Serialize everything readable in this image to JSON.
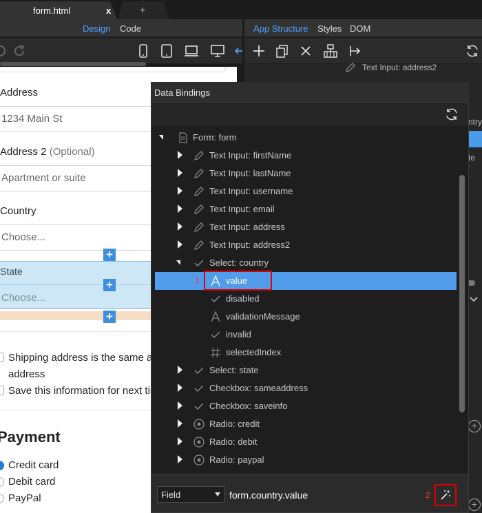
{
  "tabs": {
    "file": "form.html",
    "close": "x",
    "add": "+"
  },
  "left": {
    "modes": {
      "design": "Design",
      "code": "Code"
    }
  },
  "preview": {
    "address_label": "Address",
    "address_placeholder": "1234 Main St",
    "address2_label": "Address 2",
    "address2_optional": "(Optional)",
    "address2_placeholder": "Apartment or suite",
    "country_label": "Country",
    "country_value": "Choose...",
    "state_label": "State",
    "state_value": "Choose...",
    "plus": "+",
    "checkbox1": "Shipping address is the same as my billing address",
    "checkbox2": "Save this information for next time",
    "payment_title": "Payment",
    "radios": [
      "Credit card",
      "Debit card",
      "PayPal"
    ]
  },
  "right": {
    "tabs": {
      "app": "App Structure",
      "styles": "Styles",
      "dom": "DOM"
    },
    "selected_node": "Text Input: address2",
    "behind_text1": "ntry",
    "behind_text2": "te"
  },
  "bindings": {
    "title": "Data Bindings",
    "tree": [
      {
        "label": "Form: form",
        "icon": "document-icon"
      },
      {
        "label": "Text Input: firstName",
        "icon": "pencil-icon"
      },
      {
        "label": "Text Input: lastName",
        "icon": "pencil-icon"
      },
      {
        "label": "Text Input: username",
        "icon": "pencil-icon"
      },
      {
        "label": "Text Input: email",
        "icon": "pencil-icon"
      },
      {
        "label": "Text Input: address",
        "icon": "pencil-icon"
      },
      {
        "label": "Text Input: address2",
        "icon": "pencil-icon"
      },
      {
        "label": "Select: country",
        "icon": "check-icon"
      },
      {
        "label": "value",
        "icon": "text-icon"
      },
      {
        "label": "disabled",
        "icon": "check-icon"
      },
      {
        "label": "validationMessage",
        "icon": "text-icon"
      },
      {
        "label": "invalid",
        "icon": "check-icon"
      },
      {
        "label": "selectedIndex",
        "icon": "hash-icon"
      },
      {
        "label": "Select: state",
        "icon": "check-icon"
      },
      {
        "label": "Checkbox: sameaddress",
        "icon": "check-icon"
      },
      {
        "label": "Checkbox: saveinfo",
        "icon": "check-icon"
      },
      {
        "label": "Radio: credit",
        "icon": "radio-icon"
      },
      {
        "label": "Radio: debit",
        "icon": "radio-icon"
      },
      {
        "label": "Radio: paypal",
        "icon": "radio-icon"
      }
    ],
    "marker1": "1",
    "marker2": "2",
    "field_type": "Field",
    "expression": "form.country.value"
  },
  "colors": {
    "accent": "#4fa3ff",
    "selection": "#529cec",
    "highlight": "#e00000"
  }
}
